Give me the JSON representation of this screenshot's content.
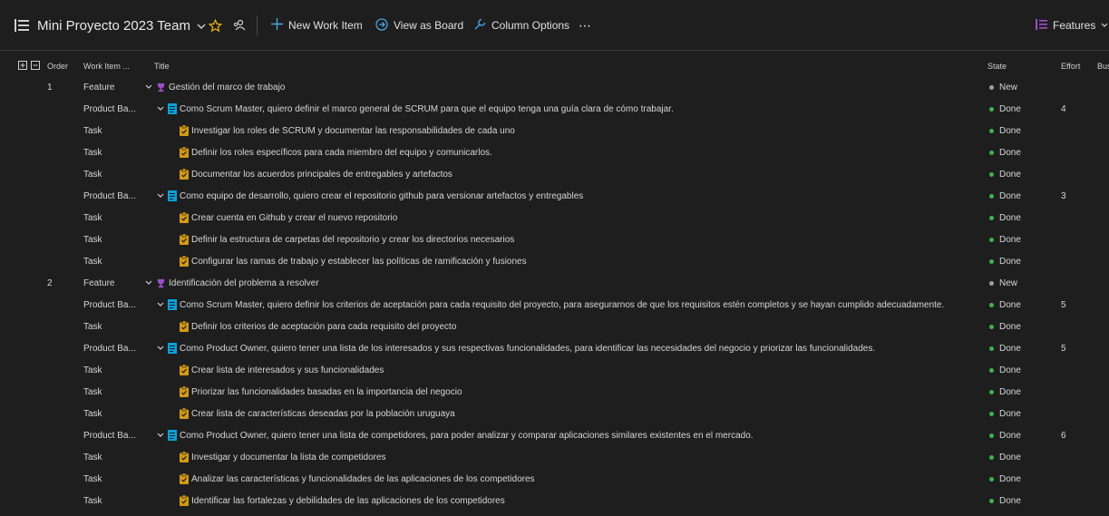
{
  "toolbar": {
    "team_name": "Mini Proyecto 2023 Team",
    "new_item_label": "New Work Item",
    "view_board_label": "View as Board",
    "column_options_label": "Column Options",
    "more_label": "⋯",
    "level_label": "Features"
  },
  "columns": {
    "order": "Order",
    "type": "Work Item ...",
    "title": "Title",
    "state": "State",
    "effort": "Effort",
    "bus": "Bus"
  },
  "colors": {
    "feature_icon": "#9b4dca",
    "pbi_icon": "#0e9fd6",
    "task_icon": "#d39a17",
    "state_new": "#a0a0a0",
    "state_done": "#3fb34f"
  },
  "rows": [
    {
      "order": "1",
      "type": "Feature",
      "kind": "feature",
      "level": 0,
      "title": "Gestión del marco de trabajo",
      "state": "New",
      "effort": ""
    },
    {
      "order": "",
      "type": "Product Ba...",
      "kind": "pbi",
      "level": 1,
      "title": "Como Scrum Master, quiero definir el marco general de SCRUM para que el equipo tenga una guía clara de cómo trabajar.",
      "state": "Done",
      "effort": "4"
    },
    {
      "order": "",
      "type": "Task",
      "kind": "task",
      "level": 2,
      "title": "Investigar los roles de SCRUM y documentar las responsabilidades de cada uno",
      "state": "Done",
      "effort": ""
    },
    {
      "order": "",
      "type": "Task",
      "kind": "task",
      "level": 2,
      "title": "Definir los roles específicos para cada miembro del equipo y comunicarlos.",
      "state": "Done",
      "effort": ""
    },
    {
      "order": "",
      "type": "Task",
      "kind": "task",
      "level": 2,
      "title": "Documentar los acuerdos principales de entregables y artefactos",
      "state": "Done",
      "effort": ""
    },
    {
      "order": "",
      "type": "Product Ba...",
      "kind": "pbi",
      "level": 1,
      "title": "Como equipo de desarrollo, quiero crear el repositorio github para versionar artefactos y entregables",
      "state": "Done",
      "effort": "3"
    },
    {
      "order": "",
      "type": "Task",
      "kind": "task",
      "level": 2,
      "title": "Crear cuenta en Github y crear el nuevo repositorio",
      "state": "Done",
      "effort": ""
    },
    {
      "order": "",
      "type": "Task",
      "kind": "task",
      "level": 2,
      "title": "Definir la estructura de carpetas del repositorio y crear los directorios necesarios",
      "state": "Done",
      "effort": ""
    },
    {
      "order": "",
      "type": "Task",
      "kind": "task",
      "level": 2,
      "title": "Configurar las ramas de trabajo y establecer las políticas de ramificación y fusiones",
      "state": "Done",
      "effort": ""
    },
    {
      "order": "2",
      "type": "Feature",
      "kind": "feature",
      "level": 0,
      "title": "Identificación del problema a resolver",
      "state": "New",
      "effort": ""
    },
    {
      "order": "",
      "type": "Product Ba...",
      "kind": "pbi",
      "level": 1,
      "title": "Como Scrum Master, quiero definir los criterios de aceptación para cada requisito del proyecto, para asegurarnos de que los requisitos estén completos y se hayan cumplido adecuadamente.",
      "state": "Done",
      "effort": "5"
    },
    {
      "order": "",
      "type": "Task",
      "kind": "task",
      "level": 2,
      "title": "Definir los criterios de aceptación para cada requisito del proyecto",
      "state": "Done",
      "effort": ""
    },
    {
      "order": "",
      "type": "Product Ba...",
      "kind": "pbi",
      "level": 1,
      "title": "Como Product Owner, quiero tener una lista de los interesados y sus respectivas funcionalidades, para identificar las necesidades del negocio y priorizar las funcionalidades.",
      "state": "Done",
      "effort": "5"
    },
    {
      "order": "",
      "type": "Task",
      "kind": "task",
      "level": 2,
      "title": "Crear lista de interesados y sus funcionalidades",
      "state": "Done",
      "effort": ""
    },
    {
      "order": "",
      "type": "Task",
      "kind": "task",
      "level": 2,
      "title": "Priorizar las funcionalidades basadas en la importancia del negocio",
      "state": "Done",
      "effort": ""
    },
    {
      "order": "",
      "type": "Task",
      "kind": "task",
      "level": 2,
      "title": "Crear lista de características deseadas por la población uruguaya",
      "state": "Done",
      "effort": ""
    },
    {
      "order": "",
      "type": "Product Ba...",
      "kind": "pbi",
      "level": 1,
      "title": "Como Product Owner, quiero tener una lista de competidores, para poder analizar y comparar aplicaciones similares existentes en el mercado.",
      "state": "Done",
      "effort": "6"
    },
    {
      "order": "",
      "type": "Task",
      "kind": "task",
      "level": 2,
      "title": "Investigar y documentar la lista de competidores",
      "state": "Done",
      "effort": ""
    },
    {
      "order": "",
      "type": "Task",
      "kind": "task",
      "level": 2,
      "title": "Analizar las características y funcionalidades de las aplicaciones de los competidores",
      "state": "Done",
      "effort": ""
    },
    {
      "order": "",
      "type": "Task",
      "kind": "task",
      "level": 2,
      "title": "Identificar las fortalezas y debilidades de las aplicaciones de los competidores",
      "state": "Done",
      "effort": ""
    }
  ]
}
